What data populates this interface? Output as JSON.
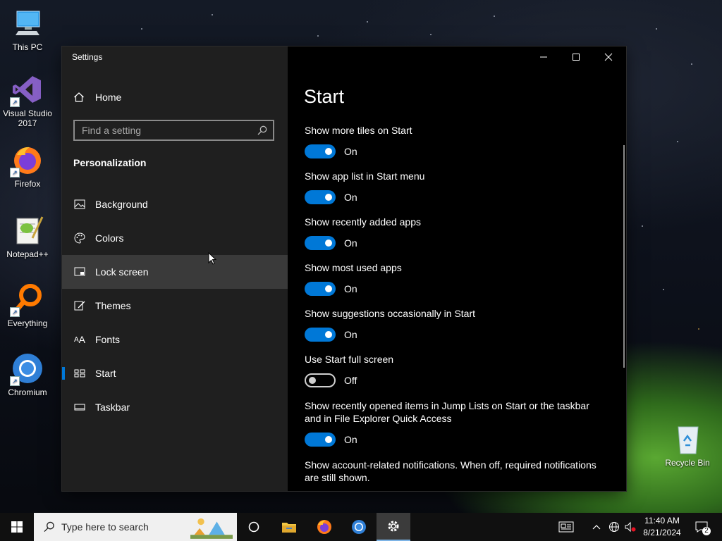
{
  "desktop": {
    "icons": [
      {
        "label": "This PC",
        "icon": "computer-icon"
      },
      {
        "label": "Visual Studio 2017",
        "icon": "visual-studio-icon"
      },
      {
        "label": "Firefox",
        "icon": "firefox-icon"
      },
      {
        "label": "Notepad++",
        "icon": "notepadpp-icon"
      },
      {
        "label": "Everything",
        "icon": "everything-icon"
      },
      {
        "label": "Chromium",
        "icon": "chromium-icon"
      },
      {
        "label": "Recycle Bin",
        "icon": "recycle-bin-icon"
      }
    ]
  },
  "window": {
    "app_title": "Settings",
    "home_label": "Home",
    "search_placeholder": "Find a setting",
    "section_title": "Personalization",
    "nav_items": [
      {
        "label": "Background",
        "icon": "picture-icon"
      },
      {
        "label": "Colors",
        "icon": "palette-icon"
      },
      {
        "label": "Lock screen",
        "icon": "lock-screen-icon"
      },
      {
        "label": "Themes",
        "icon": "brush-icon"
      },
      {
        "label": "Fonts",
        "icon": "font-icon"
      },
      {
        "label": "Start",
        "icon": "start-tiles-icon"
      },
      {
        "label": "Taskbar",
        "icon": "taskbar-icon"
      }
    ],
    "selected_nav": "Start",
    "hovered_nav": "Lock screen"
  },
  "content": {
    "page_title": "Start",
    "settings": [
      {
        "label": "Show more tiles on Start",
        "state": "On"
      },
      {
        "label": "Show app list in Start menu",
        "state": "On"
      },
      {
        "label": "Show recently added apps",
        "state": "On"
      },
      {
        "label": "Show most used apps",
        "state": "On"
      },
      {
        "label": "Show suggestions occasionally in Start",
        "state": "On"
      },
      {
        "label": "Use Start full screen",
        "state": "Off"
      },
      {
        "label": "Show recently opened items in Jump Lists on Start or the taskbar and in File Explorer Quick Access",
        "state": "On"
      },
      {
        "label": "Show account-related notifications. When off, required notifications are still shown.",
        "state": "On"
      }
    ]
  },
  "taskbar": {
    "search_placeholder": "Type here to search",
    "time": "11:40 AM",
    "date": "8/21/2024",
    "notification_count": "2",
    "accent_color": "#0078d7"
  }
}
